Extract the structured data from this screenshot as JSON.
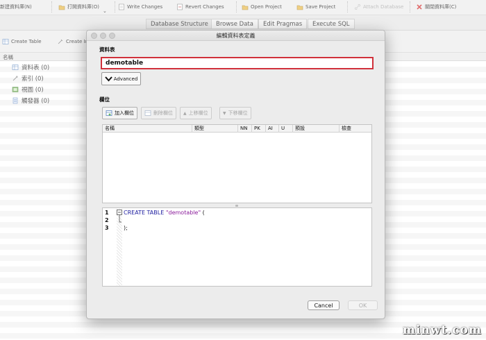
{
  "toolbar": {
    "new_db": "新建資料庫(N)",
    "open_db": "打開資料庫(O)",
    "write_changes": "Write Changes",
    "revert_changes": "Revert Changes",
    "open_project": "Open Project",
    "save_project": "Save Project",
    "attach_database": "Attach Database",
    "close_db": "關閉資料庫(C)"
  },
  "tabs": [
    {
      "label": "Database Structure",
      "active": true
    },
    {
      "label": "Browse Data",
      "active": false
    },
    {
      "label": "Edit Pragmas",
      "active": false
    },
    {
      "label": "Execute SQL",
      "active": false
    }
  ],
  "subtoolbar": {
    "create_table": "Create Table",
    "create_index": "Create In"
  },
  "tree": {
    "header": "名稱",
    "items": [
      {
        "label": "資料表 (0)",
        "icon": "table-icon"
      },
      {
        "label": "索引 (0)",
        "icon": "index-icon"
      },
      {
        "label": "視圖 (0)",
        "icon": "view-icon"
      },
      {
        "label": "觸發器 (0)",
        "icon": "trigger-icon"
      }
    ]
  },
  "dialog": {
    "title": "編輯資料表定義",
    "table_section_label": "資料表",
    "table_name": "demotable",
    "advanced_label": "Advanced",
    "fields_section_label": "欄位",
    "add_field": "加入欄位",
    "remove_field": "刪除欄位",
    "move_up": "上移欄位",
    "move_down": "下移欄位",
    "columns": [
      "名稱",
      "類型",
      "NN",
      "PK",
      "AI",
      "U",
      "預設",
      "檢查"
    ],
    "sql": {
      "line_numbers": [
        "1",
        "2",
        "3"
      ],
      "line1_keyword": "CREATE TABLE",
      "line1_name": "\"demotable\"",
      "line1_paren": " (",
      "line3": ");"
    },
    "cancel_label": "Cancel",
    "ok_label": "OK"
  },
  "watermark": "minwt.com",
  "colors": {
    "name_field_border": "#d0303a",
    "sql_keyword": "#1a1a9e",
    "sql_string": "#8a1a9a"
  }
}
